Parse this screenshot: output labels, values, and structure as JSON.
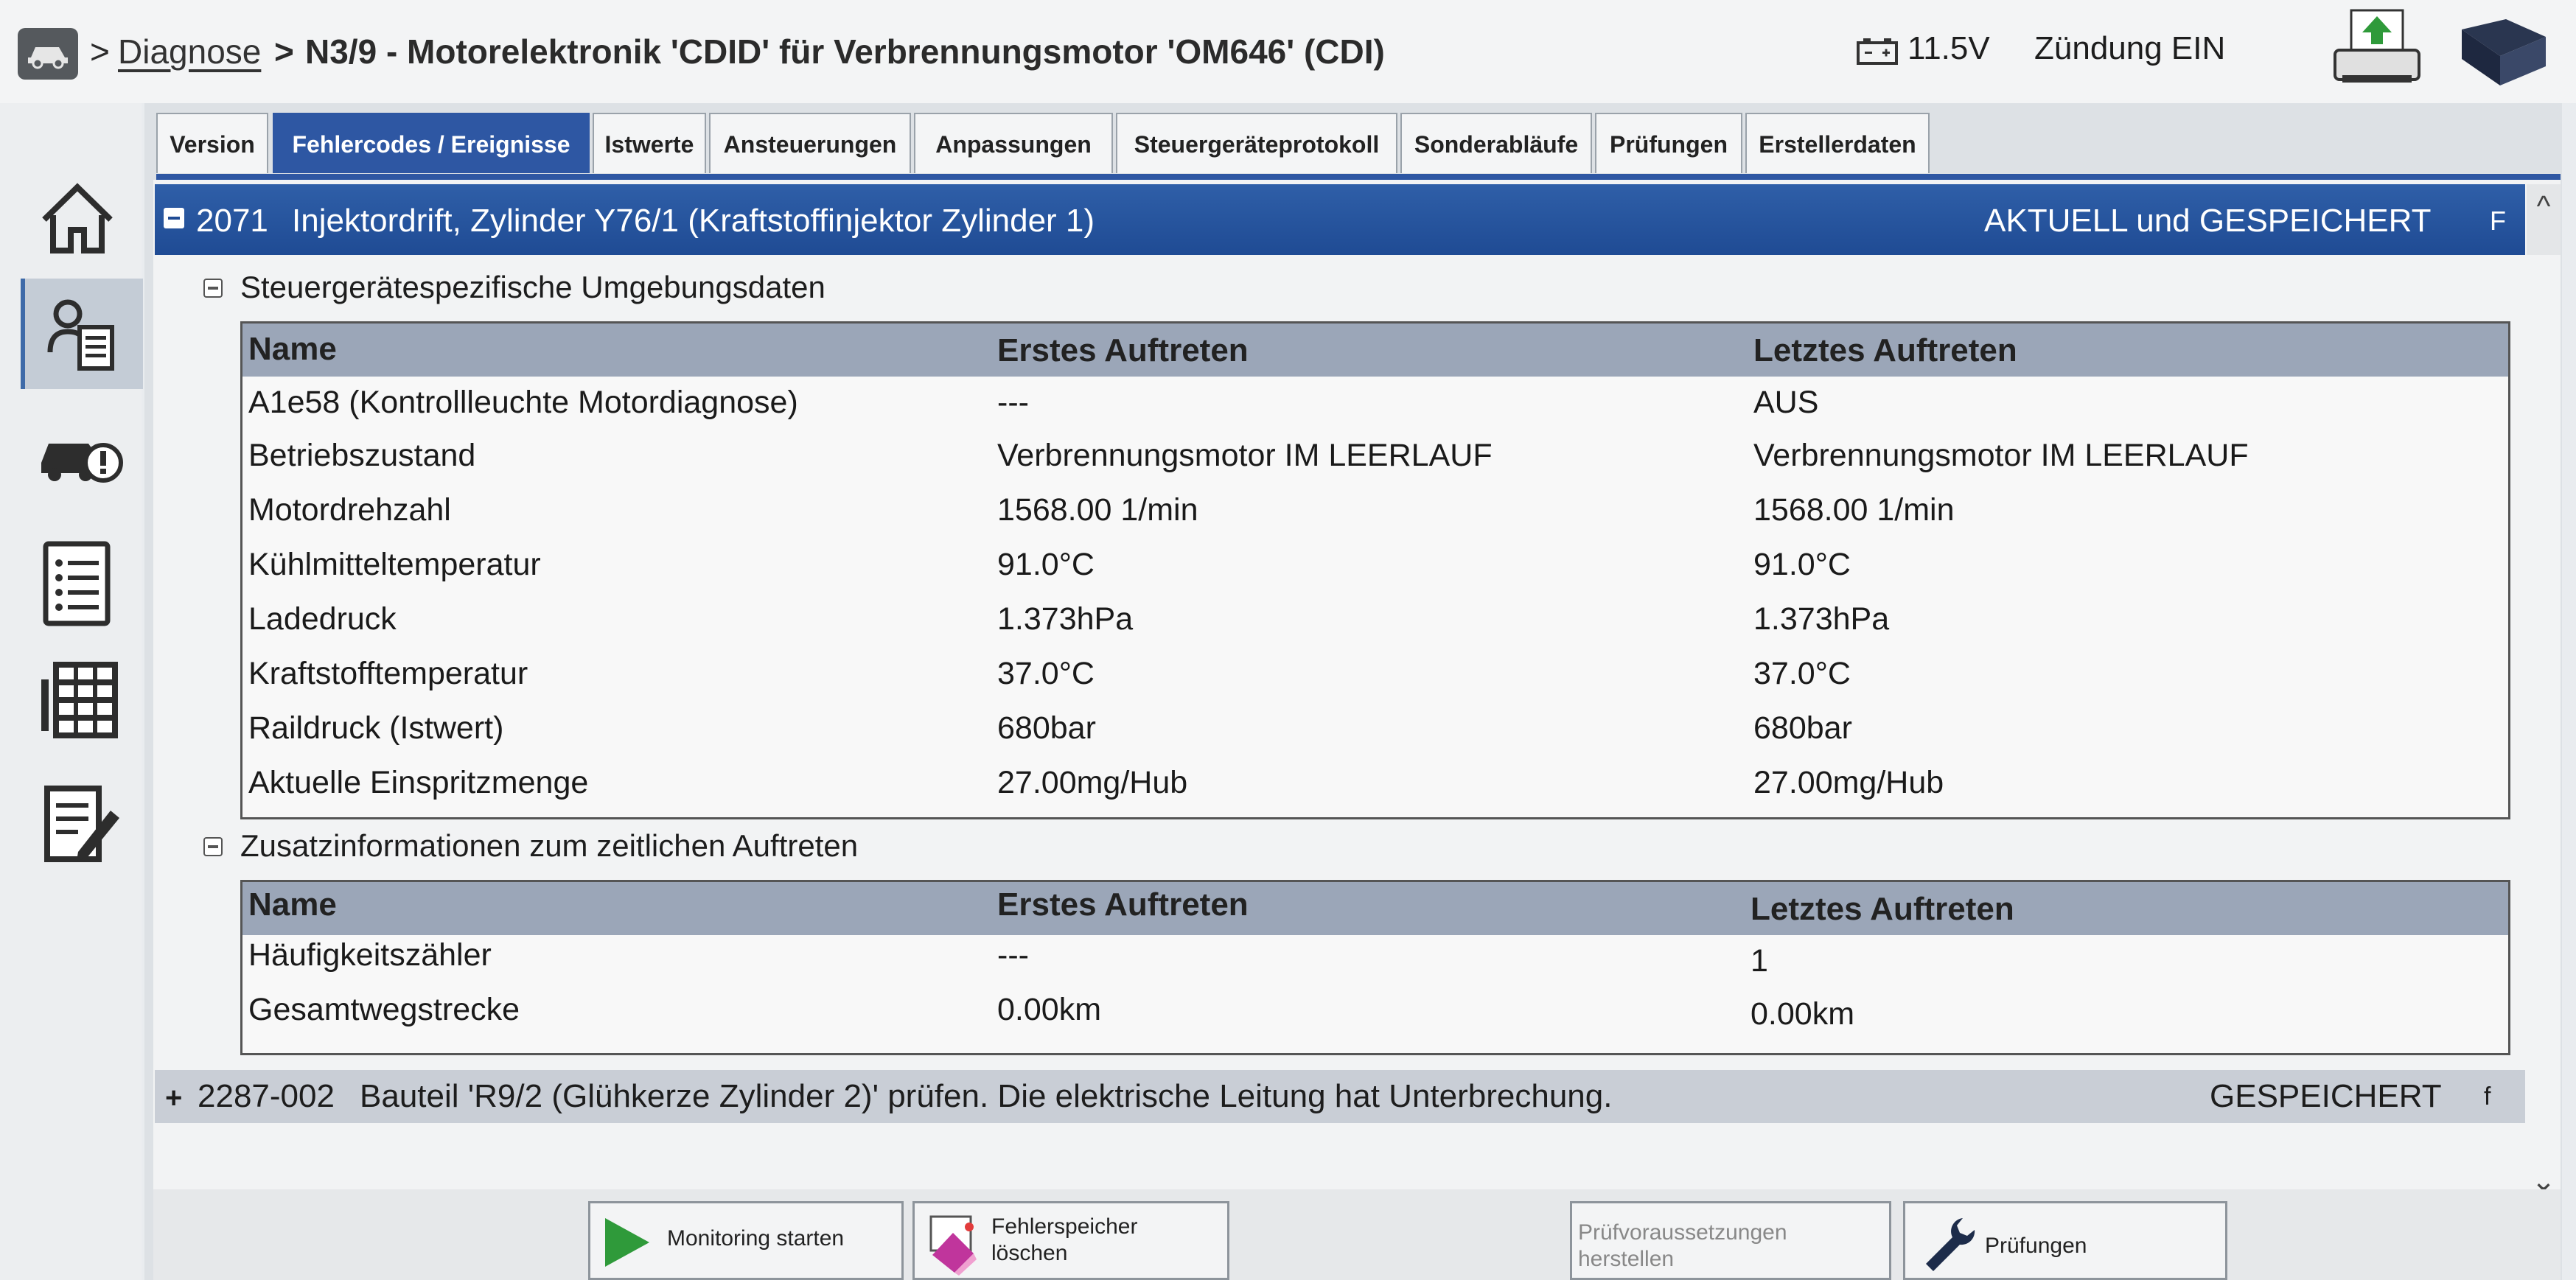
{
  "header": {
    "breadcrumb_sep": ">",
    "breadcrumb_link": "Diagnose",
    "breadcrumb_sep2": ">",
    "title": "N3/9 - Motorelektronik 'CDID' für Verbrennungsmotor 'OM646' (CDI)",
    "battery_voltage": "11.5V",
    "ignition_status": "Zündung EIN"
  },
  "tabs": [
    {
      "label": "Version"
    },
    {
      "label": "Fehlercodes / Ereignisse"
    },
    {
      "label": "Istwerte"
    },
    {
      "label": "Ansteuerungen"
    },
    {
      "label": "Anpassungen"
    },
    {
      "label": "Steuergeräteprotokoll"
    },
    {
      "label": "Sonderabläufe"
    },
    {
      "label": "Prüfungen"
    },
    {
      "label": "Erstellerdaten"
    }
  ],
  "active_tab": "Fehlercodes / Ereignisse",
  "fault1": {
    "code": "2071",
    "text": "Injektordrift, Zylinder Y76/1 (Kraftstoffinjektor Zylinder 1)",
    "status": "AKTUELL und GESPEICHERT",
    "flag": "F"
  },
  "section1": {
    "title": "Steuergerätespezifische Umgebungsdaten",
    "headers": [
      "Name",
      "Erstes Auftreten",
      "Letztes Auftreten"
    ],
    "rows": [
      [
        "A1e58 (Kontrollleuchte Motordiagnose)",
        "---",
        "AUS"
      ],
      [
        "Betriebszustand",
        "Verbrennungsmotor IM LEERLAUF",
        "Verbrennungsmotor IM LEERLAUF"
      ],
      [
        "Motordrehzahl",
        "1568.00 1/min",
        "1568.00 1/min"
      ],
      [
        "Kühlmitteltemperatur",
        "91.0°C",
        "91.0°C"
      ],
      [
        "Ladedruck",
        "1.373hPa",
        "1.373hPa"
      ],
      [
        "Kraftstofftemperatur",
        "37.0°C",
        "37.0°C"
      ],
      [
        "Raildruck (Istwert)",
        "680bar",
        "680bar"
      ],
      [
        "Aktuelle Einspritzmenge",
        "27.00mg/Hub",
        "27.00mg/Hub"
      ]
    ]
  },
  "section2": {
    "title": "Zusatzinformationen zum zeitlichen Auftreten",
    "headers": [
      "Name",
      "Erstes Auftreten",
      "Letztes Auftreten"
    ],
    "rows": [
      [
        "Häufigkeitszähler",
        "---",
        "1"
      ],
      [
        "Gesamtwegstrecke",
        "0.00km",
        "0.00km"
      ]
    ]
  },
  "fault2": {
    "expander": "+",
    "code": "2287-002",
    "text": "Bauteil 'R9/2 (Glühkerze Zylinder 2)' prüfen. Die elektrische Leitung hat Unterbrechung.",
    "status": "GESPEICHERT",
    "flag": "f"
  },
  "buttons": {
    "monitoring": "Monitoring starten",
    "clear_line1": "Fehlerspeicher",
    "clear_line2": "löschen",
    "prereq_line1": "Prüfvoraussetzungen",
    "prereq_line2": "herstellen",
    "tests": "Prüfungen"
  },
  "icons": {
    "sidebar": [
      "home-icon",
      "control-unit-list-icon",
      "vehicle-warning-icon",
      "checklist-icon",
      "grid-table-icon",
      "edit-document-icon"
    ],
    "header": [
      "car-icon",
      "battery-icon",
      "printer-icon",
      "manual-book-icon"
    ]
  },
  "colors": {
    "accent_blue": "#2e57a3",
    "table_header": "#9ba6b8",
    "fault_stored_bg": "#c9ced6"
  }
}
